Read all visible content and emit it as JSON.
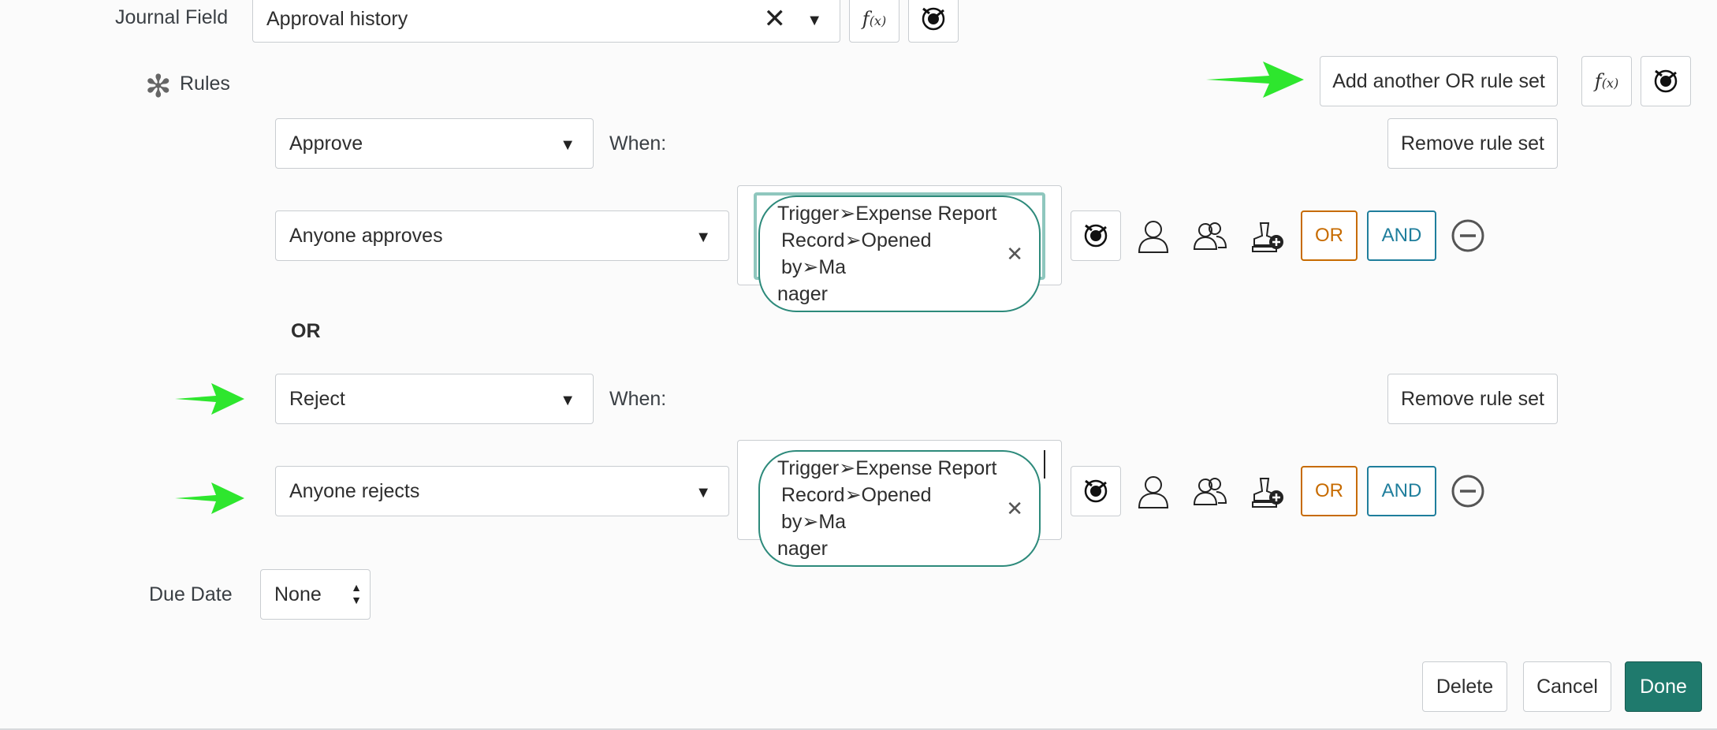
{
  "journal": {
    "label": "Journal Field",
    "value": "Approval history",
    "clear_icon": "close-icon",
    "dropdown_icon": "caret-down-icon"
  },
  "rules": {
    "label": "Rules",
    "required_icon": "asterisk-icon",
    "add_or_button": "Add another OR rule set",
    "or_separator": "OR",
    "rule_sets": [
      {
        "action": "Approve",
        "when_label": "When:",
        "remove_button": "Remove rule set",
        "condition": "Anyone approves",
        "pill_lines": [
          "Trigger➢Expense Report",
          "Record➢Opened by➢Ma",
          "nager"
        ]
      },
      {
        "action": "Reject",
        "when_label": "When:",
        "remove_button": "Remove rule set",
        "condition": "Anyone rejects",
        "pill_lines": [
          "Trigger➢Expense Report",
          "Record➢Opened by➢Ma",
          "nager"
        ]
      }
    ],
    "or_button": "OR",
    "and_button": "AND"
  },
  "due_date": {
    "label": "Due Date",
    "value": "None"
  },
  "footer": {
    "delete": "Delete",
    "cancel": "Cancel",
    "done": "Done"
  },
  "colors": {
    "accent": "#2d8a7b",
    "done_bg": "#1f7a6d",
    "or_color": "#c76b00",
    "and_color": "#1f7e9c",
    "arrow": "#2ee62e"
  }
}
